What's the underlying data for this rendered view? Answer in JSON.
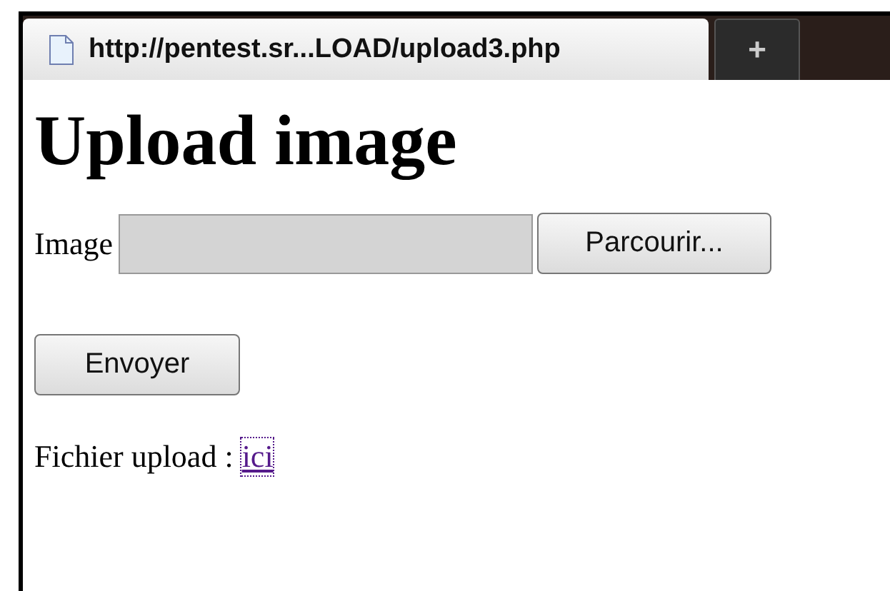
{
  "tab": {
    "title": "http://pentest.sr...LOAD/upload3.php",
    "selected": true
  },
  "new_tab_button": {
    "label": "+"
  },
  "heading": "Upload image",
  "file_field": {
    "label": "Image",
    "button": "Parcourir..."
  },
  "submit_button": "Envoyer",
  "result": {
    "text": "Fichier upload :",
    "link": "ici",
    "focused": true
  }
}
